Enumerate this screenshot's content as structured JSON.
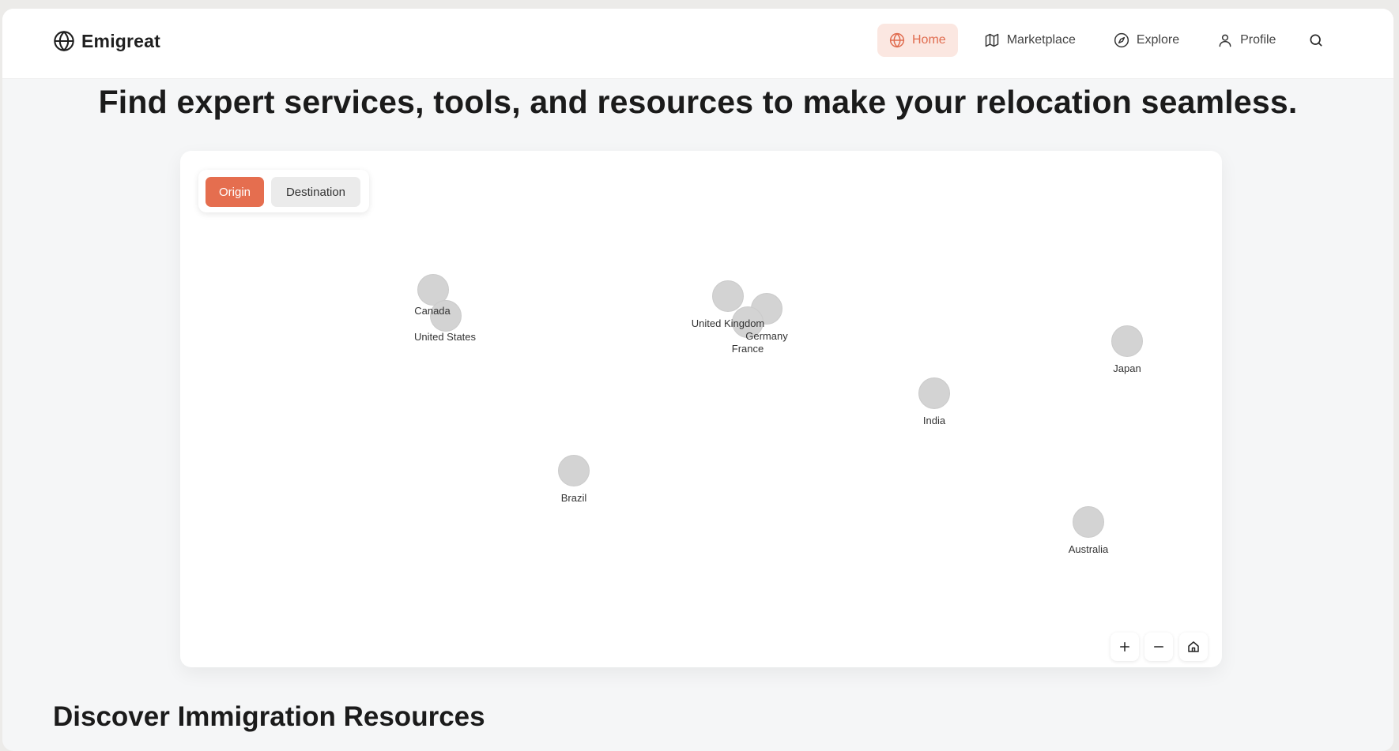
{
  "brand": {
    "name": "Emigreat",
    "logo_icon": "globe-icon"
  },
  "nav": {
    "items": [
      {
        "label": "Home",
        "icon": "globe-icon",
        "active": true
      },
      {
        "label": "Marketplace",
        "icon": "map-icon",
        "active": false
      },
      {
        "label": "Explore",
        "icon": "compass-icon",
        "active": false
      },
      {
        "label": "Profile",
        "icon": "user-icon",
        "active": false
      }
    ],
    "search_icon": "search-icon"
  },
  "hero": {
    "title": "Find expert services, tools, and resources to make your relocation seamless."
  },
  "map": {
    "toggle": {
      "origin": "Origin",
      "destination": "Destination",
      "selected": "Origin"
    },
    "countries": [
      "Canada",
      "United States",
      "United Kingdom",
      "Germany",
      "France",
      "India",
      "Japan",
      "Brazil",
      "Australia"
    ],
    "controls": {
      "zoom_in": "+",
      "zoom_out": "−",
      "home_icon": "home-icon"
    }
  },
  "section": {
    "title": "Discover Immigration Resources"
  },
  "colors": {
    "accent": "#E56E4F",
    "accent_soft": "#FBE7E1",
    "marker": "#D3D3D3"
  }
}
